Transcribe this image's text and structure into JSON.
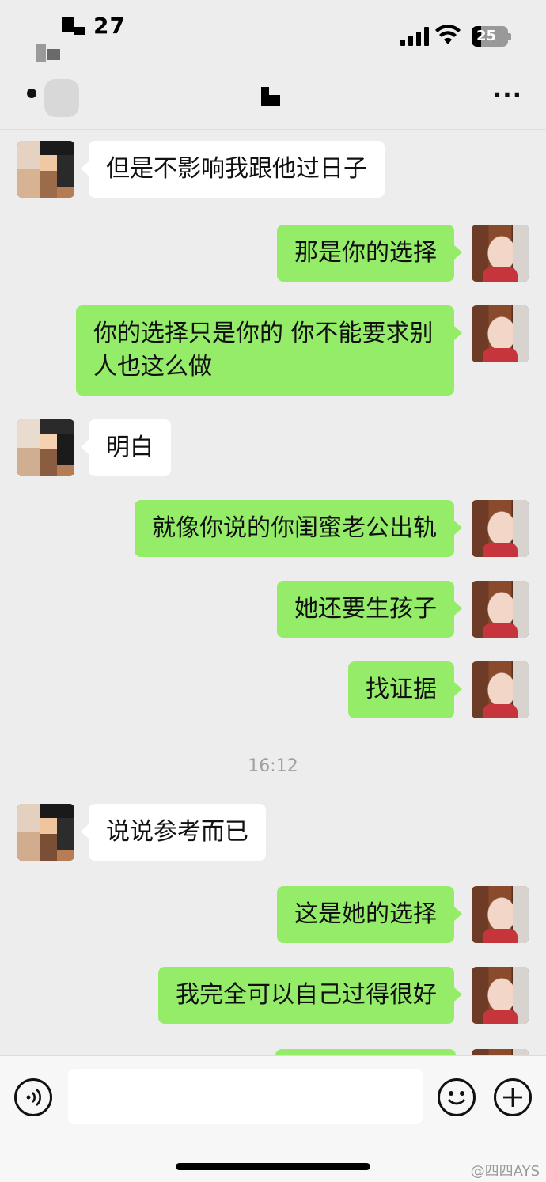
{
  "status_bar": {
    "time": "27",
    "battery": "25"
  },
  "nav": {
    "more_label": "···"
  },
  "messages": [
    {
      "side": "in",
      "text": "但是不影响我跟他过日子"
    },
    {
      "side": "out",
      "text": "那是你的选择"
    },
    {
      "side": "out",
      "text": "你的选择只是你的 你不能要求别人也这么做"
    },
    {
      "side": "in",
      "text": "明白"
    },
    {
      "side": "out",
      "text": "就像你说的你闺蜜老公出轨"
    },
    {
      "side": "out",
      "text": "她还要生孩子"
    },
    {
      "side": "out",
      "text": "找证据"
    },
    {
      "side": "in",
      "text": "说说参考而已"
    },
    {
      "side": "out",
      "text": "这是她的选择"
    },
    {
      "side": "out",
      "text": "我完全可以自己过得很好"
    }
  ],
  "timestamp": "16:12",
  "watermark": "@四四AYS"
}
